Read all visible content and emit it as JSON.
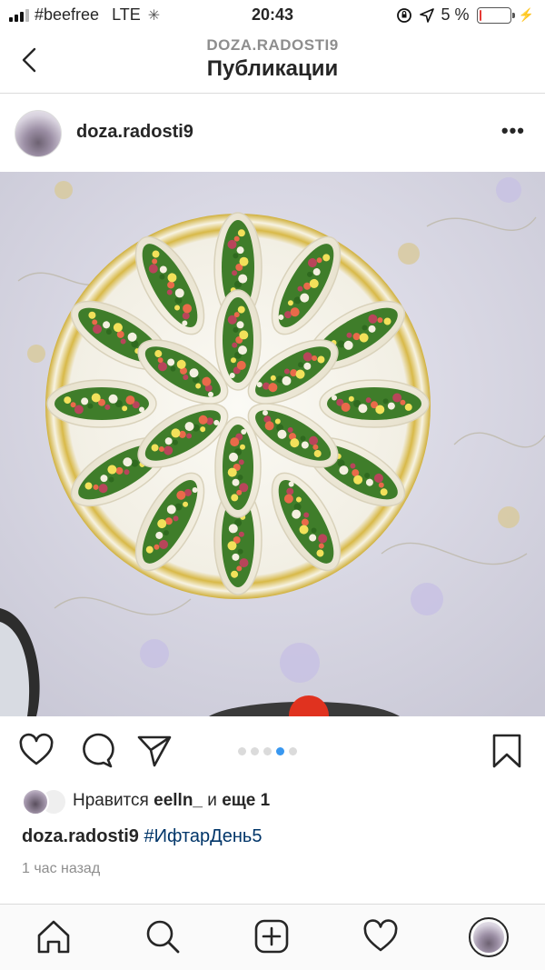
{
  "status": {
    "carrier": "#beefree",
    "network": "LTE",
    "time": "20:43",
    "battery": "5 %",
    "battery_level": 0.05
  },
  "nav": {
    "subtitle": "DOZA.RADOSTI9",
    "title": "Публикации"
  },
  "post": {
    "username": "doza.radosti9",
    "more": "•••",
    "image_description_icon": "photo-of-lavash-rolls-on-plate",
    "carousel": {
      "count": 5,
      "active": 4
    }
  },
  "likes": {
    "prefix": "Нравится",
    "user": "eelln_",
    "middle": "и",
    "suffix": "еще 1"
  },
  "caption": {
    "user": "doza.radosti9",
    "hashtag": "#ИфтарДень5"
  },
  "time_ago": "1 час назад",
  "colors": {
    "accent_blue": "#3897f0",
    "hashtag": "#003569",
    "battery_low": "#e53935"
  }
}
